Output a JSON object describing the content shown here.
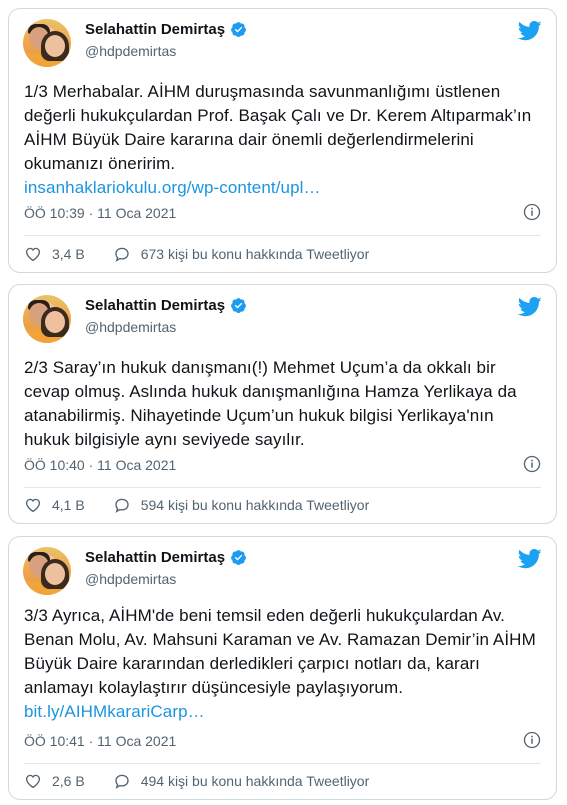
{
  "tweets": [
    {
      "name": "Selahattin Demirtaş",
      "handle": "@hdpdemirtas",
      "text": "1/3 Merhabalar. AİHM duruşmasında savunmanlığımı üstlenen değerli hukukçulardan Prof. Başak Çalı ve Dr. Kerem Altıparmak’ın AİHM Büyük Daire kararına dair önemli değerlendirmelerini okumanızı öneririm.",
      "link": "insanhaklariokulu.org/wp-content/upl…",
      "time": "ÖÖ 10:39 · 11 Oca 2021",
      "likes": "3,4 B",
      "retweet_text": "673 kişi bu konu hakkında Tweetliyor"
    },
    {
      "name": "Selahattin Demirtaş",
      "handle": "@hdpdemirtas",
      "text": "2/3 Saray’ın hukuk danışmanı(!) Mehmet Uçum’a da okkalı bir cevap olmuş. Aslında hukuk danışmanlığına Hamza Yerlikaya da atanabilirmiş. Nihayetinde Uçum’un hukuk bilgisi Yerlikaya'nın hukuk bilgisiyle aynı seviyede sayılır.",
      "link": "",
      "time": "ÖÖ 10:40 · 11 Oca 2021",
      "likes": "4,1 B",
      "retweet_text": "594 kişi bu konu hakkında Tweetliyor"
    },
    {
      "name": "Selahattin Demirtaş",
      "handle": "@hdpdemirtas",
      "text": "3/3 Ayrıca, AİHM'de beni temsil eden değerli hukukçulardan Av. Benan Molu, Av. Mahsuni Karaman ve Av. Ramazan Demir’in AİHM Büyük Daire kararından derledikleri çarpıcı notları da, kararı anlamayı kolaylaştırır düşüncesiyle paylaşıyorum.",
      "link": "bit.ly/AIHMkarariCarp…",
      "time": "ÖÖ 10:41 · 11 Oca 2021",
      "likes": "2,6 B",
      "retweet_text": "494 kişi bu konu hakkında Tweetliyor"
    }
  ],
  "colors": {
    "link": "#1b95e0",
    "verified": "#1d9bf0",
    "bird": "#1da1f2",
    "muted": "#536471"
  },
  "icons": {
    "verified": "verified-badge-icon",
    "brand": "twitter-bird-icon",
    "info": "info-icon",
    "like": "heart-icon",
    "reply": "speech-bubble-icon"
  }
}
